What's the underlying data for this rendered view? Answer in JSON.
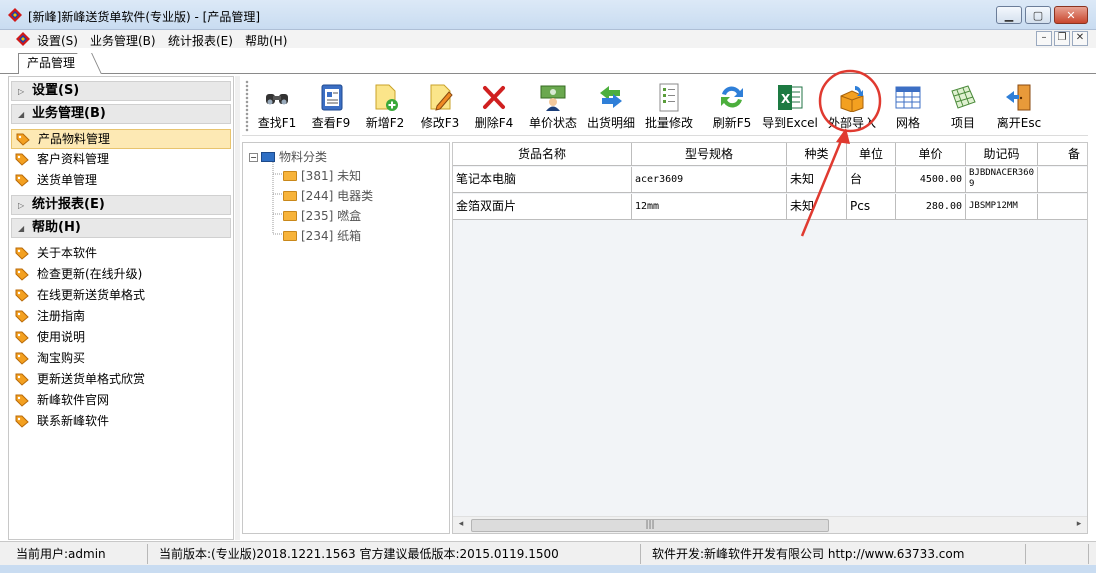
{
  "window": {
    "title": "[新峰]新峰送货单软件(专业版) - [产品管理]",
    "controls": [
      "minimize",
      "maximize",
      "close"
    ]
  },
  "menu": {
    "items": [
      "设置(S)",
      "业务管理(B)",
      "统计报表(E)",
      "帮助(H)"
    ]
  },
  "tabs": [
    "产品管理"
  ],
  "sidebar": {
    "sections": [
      {
        "label": "设置(S)",
        "expanded": false,
        "items": []
      },
      {
        "label": "业务管理(B)",
        "expanded": true,
        "items": [
          "产品物料管理",
          "客户资料管理",
          "送货单管理"
        ]
      },
      {
        "label": "统计报表(E)",
        "expanded": false,
        "items": []
      },
      {
        "label": "帮助(H)",
        "expanded": true,
        "items": [
          "关于本软件",
          "检查更新(在线升级)",
          "在线更新送货单格式",
          "注册指南",
          "使用说明",
          "淘宝购买",
          "更新送货单格式欣赏",
          "新峰软件官网",
          "联系新峰软件"
        ]
      }
    ],
    "active_item": "产品物料管理"
  },
  "toolbar": {
    "buttons": [
      {
        "label": "查找F1",
        "icon": "binoculars-icon"
      },
      {
        "label": "查看F9",
        "icon": "view-document-icon"
      },
      {
        "label": "新增F2",
        "icon": "new-document-icon"
      },
      {
        "label": "修改F3",
        "icon": "edit-document-icon"
      },
      {
        "label": "删除F4",
        "icon": "delete-x-icon"
      },
      {
        "label": "单价状态",
        "icon": "price-status-icon"
      },
      {
        "label": "出货明细",
        "icon": "shipping-arrows-icon"
      },
      {
        "label": "批量修改",
        "icon": "checklist-icon"
      },
      {
        "label": "刷新F5",
        "icon": "refresh-icon"
      },
      {
        "label": "导到Excel",
        "icon": "excel-icon"
      },
      {
        "label": "外部导入",
        "icon": "import-box-icon"
      },
      {
        "label": "网格",
        "icon": "grid-icon"
      },
      {
        "label": "项目",
        "icon": "project-table-icon"
      },
      {
        "label": "离开Esc",
        "icon": "exit-door-icon"
      }
    ]
  },
  "tree": {
    "root": "物料分类",
    "children": [
      "[381] 未知",
      "[244] 电器类",
      "[235] 嘫盒",
      "[234] 纸箱"
    ]
  },
  "grid": {
    "columns": [
      "货品名称",
      "型号规格",
      "种类",
      "单位",
      "单价",
      "助记码",
      "备"
    ],
    "rows": [
      [
        "笔记本电脑",
        "acer3609",
        "未知",
        "台",
        "4500.00",
        "BJBDNACER3609",
        ""
      ],
      [
        "金箔双面片",
        "12mm",
        "未知",
        "Pcs",
        "280.00",
        "JBSMP12MM",
        ""
      ]
    ],
    "scroll_thumb_label": "|||"
  },
  "statusbar": {
    "user": "当前用户:admin",
    "version": "当前版本:(专业版)2018.1221.1563 官方建议最低版本:2015.0119.1500",
    "developer": "软件开发:新峰软件开发有限公司 http://www.63733.com"
  },
  "colors": {
    "annotation_red": "#e03a30",
    "active_nav_bg": "#fde9b4"
  }
}
